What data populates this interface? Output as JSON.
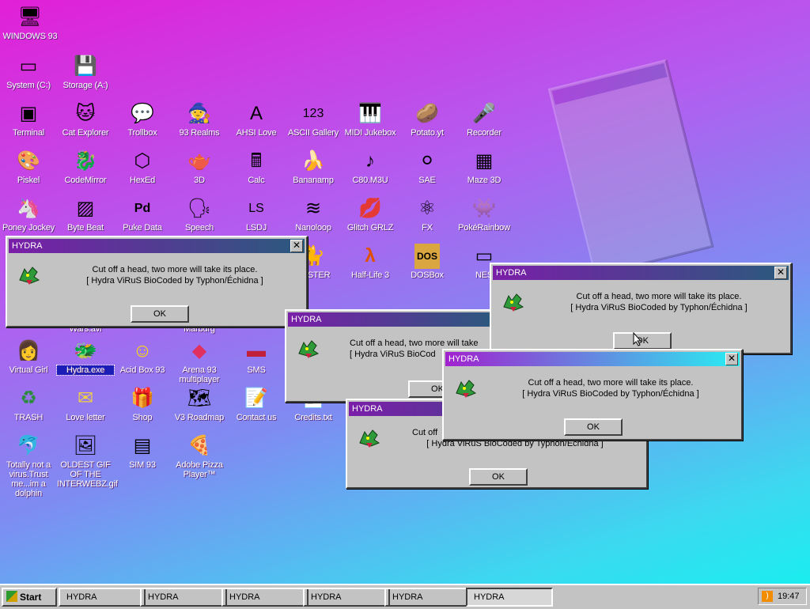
{
  "desktop_icons": [
    {
      "label": "WINDOWS 93",
      "glyph": "🖥"
    },
    {
      "label": "System (C:)",
      "glyph": "▭"
    },
    {
      "label": "Storage (A:)",
      "glyph": "💾"
    },
    {
      "label": "Terminal",
      "glyph": "▣"
    },
    {
      "label": "Cat Explorer",
      "glyph": "🐱"
    },
    {
      "label": "Trollbox",
      "glyph": "💬"
    },
    {
      "label": "93 Realms",
      "glyph": "🧙"
    },
    {
      "label": "AHSI Love",
      "glyph": "A"
    },
    {
      "label": "ASCII Gallery",
      "glyph": "123"
    },
    {
      "label": "MIDI Jukebox",
      "glyph": "🎹"
    },
    {
      "label": "Potato.yt",
      "glyph": "🥔"
    },
    {
      "label": "Recorder",
      "glyph": "🎤"
    },
    {
      "label": "Piskel",
      "glyph": "🎨"
    },
    {
      "label": "CodeMirror",
      "glyph": "🐉"
    },
    {
      "label": "HexEd",
      "glyph": "⬡"
    },
    {
      "label": "3D",
      "glyph": "🫖"
    },
    {
      "label": "Calc",
      "glyph": "🖩"
    },
    {
      "label": "Bananamp",
      "glyph": "🍌"
    },
    {
      "label": "C80.M3U",
      "glyph": "♪"
    },
    {
      "label": "SAE",
      "glyph": "⚪"
    },
    {
      "label": "Maze 3D",
      "glyph": "▦"
    },
    {
      "label": "Poney Jockey",
      "glyph": "🦄"
    },
    {
      "label": "Byte Beat",
      "glyph": "▨"
    },
    {
      "label": "Puke Data",
      "glyph": "Pd"
    },
    {
      "label": "Speech",
      "glyph": "🗣"
    },
    {
      "label": "LSDJ",
      "glyph": "LS"
    },
    {
      "label": "Nanoloop",
      "glyph": "≋"
    },
    {
      "label": "Glitch GRLZ",
      "glyph": "💋"
    },
    {
      "label": "FX",
      "glyph": "⚛"
    },
    {
      "label": "PokéRainbow",
      "glyph": "👾"
    },
    {
      "label": "Wars.avi",
      "glyph": ""
    },
    {
      "label": "Marburg",
      "glyph": ""
    },
    {
      "label": "Virtual Girl",
      "glyph": "👩"
    },
    {
      "label": "Hydra.exe",
      "glyph": "🐲"
    },
    {
      "label": "Acid Box 93",
      "glyph": "☺"
    },
    {
      "label": "Arena 93 multiplayer",
      "glyph": "◆"
    },
    {
      "label": "SMS",
      "glyph": "▬"
    },
    {
      "label": "TRASH",
      "glyph": "♻"
    },
    {
      "label": "Love letter",
      "glyph": "✉"
    },
    {
      "label": "Shop",
      "glyph": "🎁"
    },
    {
      "label": "V3 Roadmap",
      "glyph": "🗺"
    },
    {
      "label": "Contact us",
      "glyph": "📝"
    },
    {
      "label": "Credits.txt",
      "glyph": ""
    },
    {
      "label": "Totally not a virus.Trust me...im a dolphin",
      "glyph": "🐬"
    },
    {
      "label": "OLDEST GIF OF THE INTERWEBZ.gif",
      "glyph": "🖼"
    },
    {
      "label": "SIM 93",
      "glyph": "▤"
    },
    {
      "label": "Adobe Pizza Player™",
      "glyph": "🍕"
    },
    {
      "label": "SPSTER",
      "glyph": ""
    },
    {
      "label": "Half-Life 3",
      "glyph": "λ"
    },
    {
      "label": "DOSBox",
      "glyph": "DOS"
    },
    {
      "label": "NES",
      "glyph": ""
    }
  ],
  "dialog": {
    "title": "HYDRA",
    "line1": "Cut off a head, two more will take its place.",
    "line2": "[ Hydra ViRuS BioCoded by Typhon/Échidna ]",
    "ok": "OK",
    "close": "✕"
  },
  "dialog_partial": {
    "line1": "Cut off a head, two more will take",
    "line2": "[ Hydra ViRuS BioCod",
    "ok": "OK",
    "line1_short": "Cut off",
    "line2_full": "[ Hydra ViRuS BioCoded by Typhon/Échidna ]"
  },
  "taskbar": {
    "start": "Start",
    "tasks": [
      "HYDRA",
      "HYDRA",
      "HYDRA",
      "HYDRA",
      "HYDRA",
      "HYDRA"
    ],
    "clock": "19:47",
    "rss": ")"
  },
  "colors": {
    "bg_top": "#e21fd6",
    "bg_bottom": "#13f2ee",
    "title_purple": "#7a1ea8",
    "title_cyan": "#28eef2",
    "window": "#c3c3c3"
  }
}
